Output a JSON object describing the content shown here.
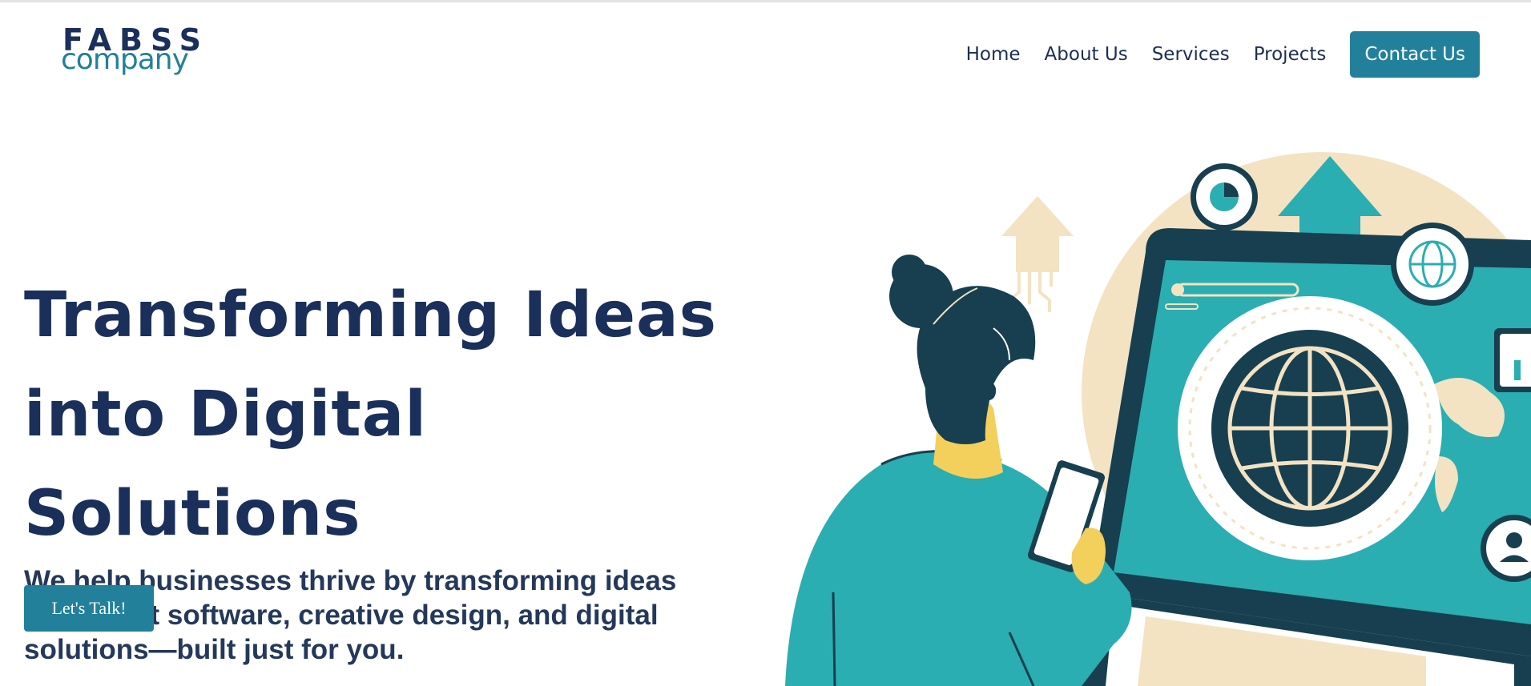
{
  "logo": {
    "line1": "FABSS",
    "line2": "company"
  },
  "nav": {
    "items": [
      {
        "label": "Home"
      },
      {
        "label": "About Us"
      },
      {
        "label": "Services"
      },
      {
        "label": "Projects"
      }
    ],
    "cta_label": "Contact Us"
  },
  "hero": {
    "title_line1": "Transforming Ideas",
    "title_line2": "into Digital Solutions",
    "subtitle": "We help businesses thrive by transforming ideas into smart software, creative design, and digital solutions—built just for you.",
    "cta_label": "Let's Talk!"
  },
  "colors": {
    "brand_navy": "#1a2f5a",
    "brand_teal": "#22809a",
    "illustration_teal": "#2aaeb1",
    "illustration_dark": "#173f4f",
    "illustration_beige": "#f3e3c3",
    "illustration_yellow": "#f3cf5c"
  },
  "illustration": {
    "semantic": "woman-using-phone-with-laptop-globe-illustration"
  }
}
